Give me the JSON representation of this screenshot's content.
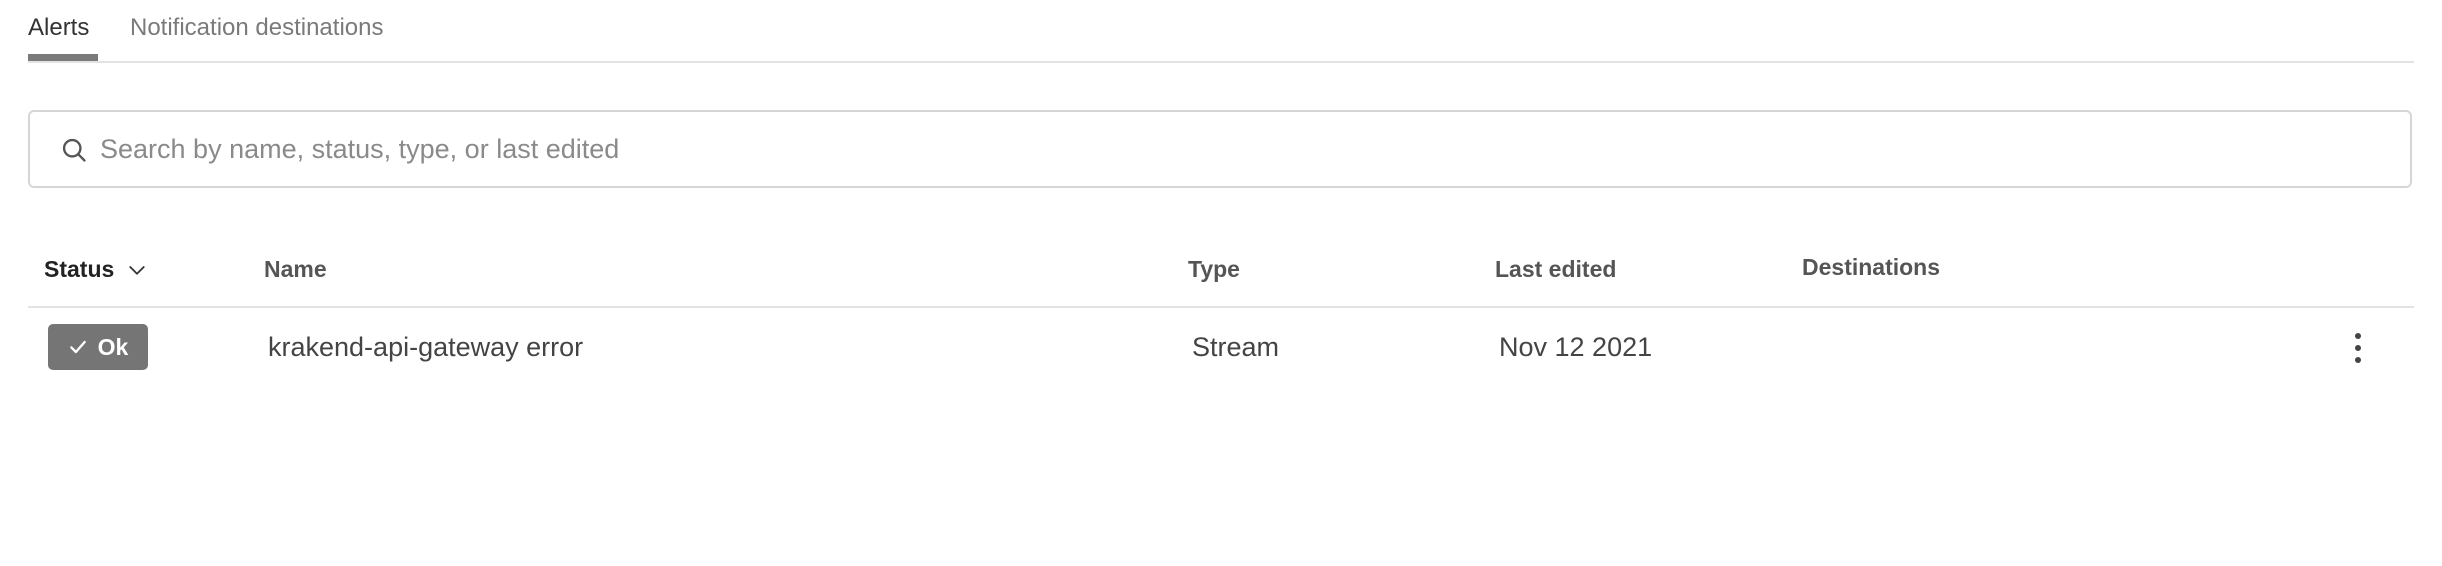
{
  "tabs": [
    {
      "label": "Alerts",
      "active": true
    },
    {
      "label": "Notification destinations",
      "active": false
    }
  ],
  "search": {
    "placeholder": "Search by name, status, type, or last edited",
    "value": ""
  },
  "table": {
    "columns": {
      "status": "Status",
      "name": "Name",
      "type": "Type",
      "last_edited": "Last edited",
      "destinations": "Destinations"
    },
    "rows": [
      {
        "status": "Ok",
        "name": "krakend-api-gateway error",
        "type": "Stream",
        "last_edited": "Nov 12 2021",
        "destinations": ""
      }
    ]
  },
  "icons": {
    "search": "search-icon",
    "sort": "chevron-down-icon",
    "status": "check-icon",
    "row_menu": "more-vertical-icon"
  },
  "colors": {
    "badge_ok": "#757575",
    "tab_indicator": "#7a7a7a",
    "border": "#d6d6d6"
  }
}
